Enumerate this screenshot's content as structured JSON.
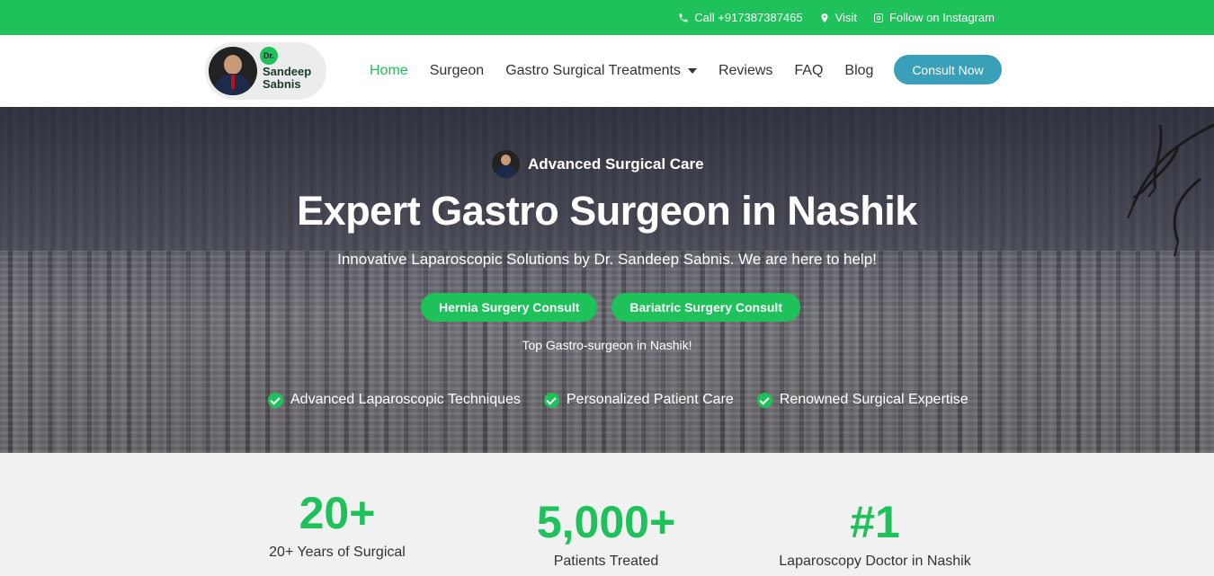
{
  "topbar": {
    "call": "Call +917387387465",
    "visit": "Visit",
    "instagram": "Follow on Instagram"
  },
  "logo": {
    "prefix": "Dr.",
    "first": "Sandeep",
    "last": "Sabnis"
  },
  "nav": {
    "items": [
      {
        "label": "Home"
      },
      {
        "label": "Surgeon"
      },
      {
        "label": "Gastro Surgical Treatments"
      },
      {
        "label": "Reviews"
      },
      {
        "label": "FAQ"
      },
      {
        "label": "Blog"
      }
    ],
    "active": "Home",
    "cta": "Consult Now"
  },
  "hero": {
    "badge": "Advanced Surgical Care",
    "title": "Expert Gastro Surgeon in Nashik",
    "subtitle": "Innovative Laparoscopic Solutions by Dr. Sandeep Sabnis. We are here to help!",
    "buttons": [
      "Hernia Surgery Consult",
      "Bariatric Surgery Consult"
    ],
    "tagline": "Top Gastro-surgeon in Nashik!",
    "features": [
      "Advanced Laparoscopic Techniques",
      "Personalized Patient Care",
      "Renowned Surgical Expertise"
    ]
  },
  "stats": [
    {
      "number": "20+",
      "label": "20+ Years of Surgical"
    },
    {
      "number": "5,000+",
      "label": "Patients Treated"
    },
    {
      "number": "#1",
      "label": "Laparoscopy Doctor in Nashik"
    }
  ],
  "colors": {
    "accent": "#1fc15a",
    "cta": "#3a9fb8"
  }
}
